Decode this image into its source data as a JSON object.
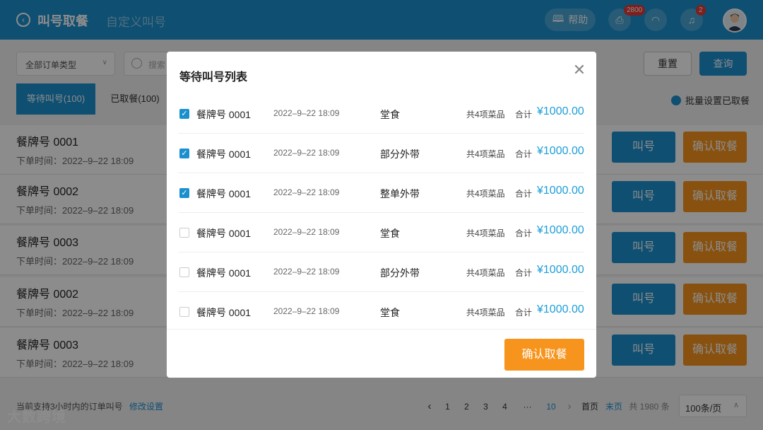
{
  "header": {
    "title": "叫号取餐",
    "subtitle": "自定义叫号",
    "help_label": "帮助",
    "printer_badge": "2800",
    "bell_badge": "2"
  },
  "filters": {
    "order_type": "全部订单类型",
    "search_placeholder": "搜索",
    "reset_label": "重置",
    "query_label": "查询"
  },
  "tabs": {
    "waiting": "等待叫号(100)",
    "taken": "已取餐(100)"
  },
  "batch_label": "批量设置已取餐",
  "rows": [
    {
      "no": "餐牌号 0001",
      "time": "下单时间：2022–9–22 18:09"
    },
    {
      "no": "餐牌号 0002",
      "time": "下单时间：2022–9–22 18:09"
    },
    {
      "no": "餐牌号 0003",
      "time": "下单时间：2022–9–22 18:09"
    },
    {
      "no": "餐牌号 0002",
      "time": "下单时间：2022–9–22 18:09"
    },
    {
      "no": "餐牌号 0003",
      "time": "下单时间：2022–9–22 18:09"
    }
  ],
  "row_buttons": {
    "call": "叫号",
    "confirm": "确认取餐"
  },
  "footer": {
    "note": "当前支持3小时内的订单叫号",
    "note_link": "修改设置",
    "pages": [
      "1",
      "2",
      "3",
      "4",
      "···",
      "10"
    ],
    "first": "首页",
    "last": "末页",
    "total": "共 1980 条",
    "page_size": "100条/页"
  },
  "watermark": "大数跨境",
  "modal": {
    "title": "等待叫号列表",
    "confirm_label": "确认取餐",
    "items": [
      {
        "checked": true,
        "no": "餐牌号 0001",
        "time": "2022–9–22 18:09",
        "type": "堂食",
        "count": "共4项菜品",
        "total_label": "合计",
        "amount": "¥1000.00"
      },
      {
        "checked": true,
        "no": "餐牌号 0001",
        "time": "2022–9–22 18:09",
        "type": "部分外带",
        "count": "共4项菜品",
        "total_label": "合计",
        "amount": "¥1000.00"
      },
      {
        "checked": true,
        "no": "餐牌号 0001",
        "time": "2022–9–22 18:09",
        "type": "整单外带",
        "count": "共4项菜品",
        "total_label": "合计",
        "amount": "¥1000.00"
      },
      {
        "checked": false,
        "no": "餐牌号 0001",
        "time": "2022–9–22 18:09",
        "type": "堂食",
        "count": "共4项菜品",
        "total_label": "合计",
        "amount": "¥1000.00"
      },
      {
        "checked": false,
        "no": "餐牌号 0001",
        "time": "2022–9–22 18:09",
        "type": "部分外带",
        "count": "共4项菜品",
        "total_label": "合计",
        "amount": "¥1000.00"
      },
      {
        "checked": false,
        "no": "餐牌号 0001",
        "time": "2022–9–22 18:09",
        "type": "堂食",
        "count": "共4项菜品",
        "total_label": "合计",
        "amount": "¥1000.00"
      }
    ]
  }
}
